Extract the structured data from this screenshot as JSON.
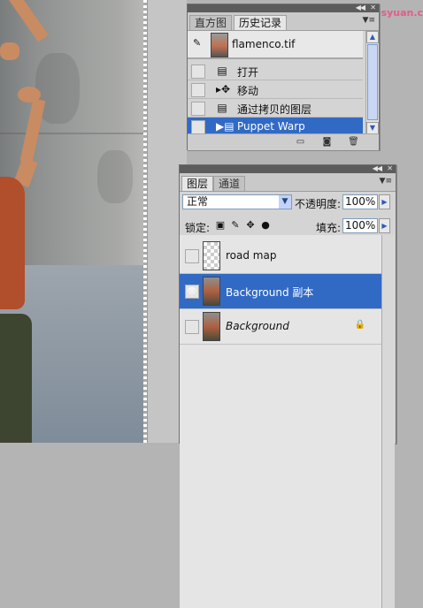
{
  "watermark": "思缘设计论坛 www.missyuan.com",
  "history_panel": {
    "tabs": [
      "直方图",
      "历史记录"
    ],
    "snapshot": "flamenco.tif",
    "states": [
      {
        "icon": "state-icon",
        "label": "打开"
      },
      {
        "icon": "move-tool-icon",
        "label": "移动"
      },
      {
        "icon": "state-icon",
        "label": "通过拷贝的图层"
      },
      {
        "icon": "state-icon",
        "label": "Puppet Warp",
        "selected": true
      }
    ],
    "footer_icons": [
      "new-document-from-state-icon",
      "new-snapshot-icon",
      "delete-state-icon"
    ]
  },
  "layers_panel": {
    "tabs": [
      "图层",
      "通道"
    ],
    "blend_mode": "正常",
    "opacity_label": "不透明度:",
    "opacity": "100%",
    "lock_label": "锁定:",
    "fill_label": "填充:",
    "fill": "100%",
    "layers": [
      {
        "name": "road map",
        "visible": false,
        "selected": false,
        "locked": false
      },
      {
        "name": "Background 副本",
        "visible": true,
        "selected": true,
        "locked": false
      },
      {
        "name": "Background",
        "visible": false,
        "selected": false,
        "locked": true
      }
    ]
  },
  "colors": {
    "selection": "#316ac5",
    "panel": "#d4d4d4",
    "titlebar": "#5c5c5c"
  }
}
